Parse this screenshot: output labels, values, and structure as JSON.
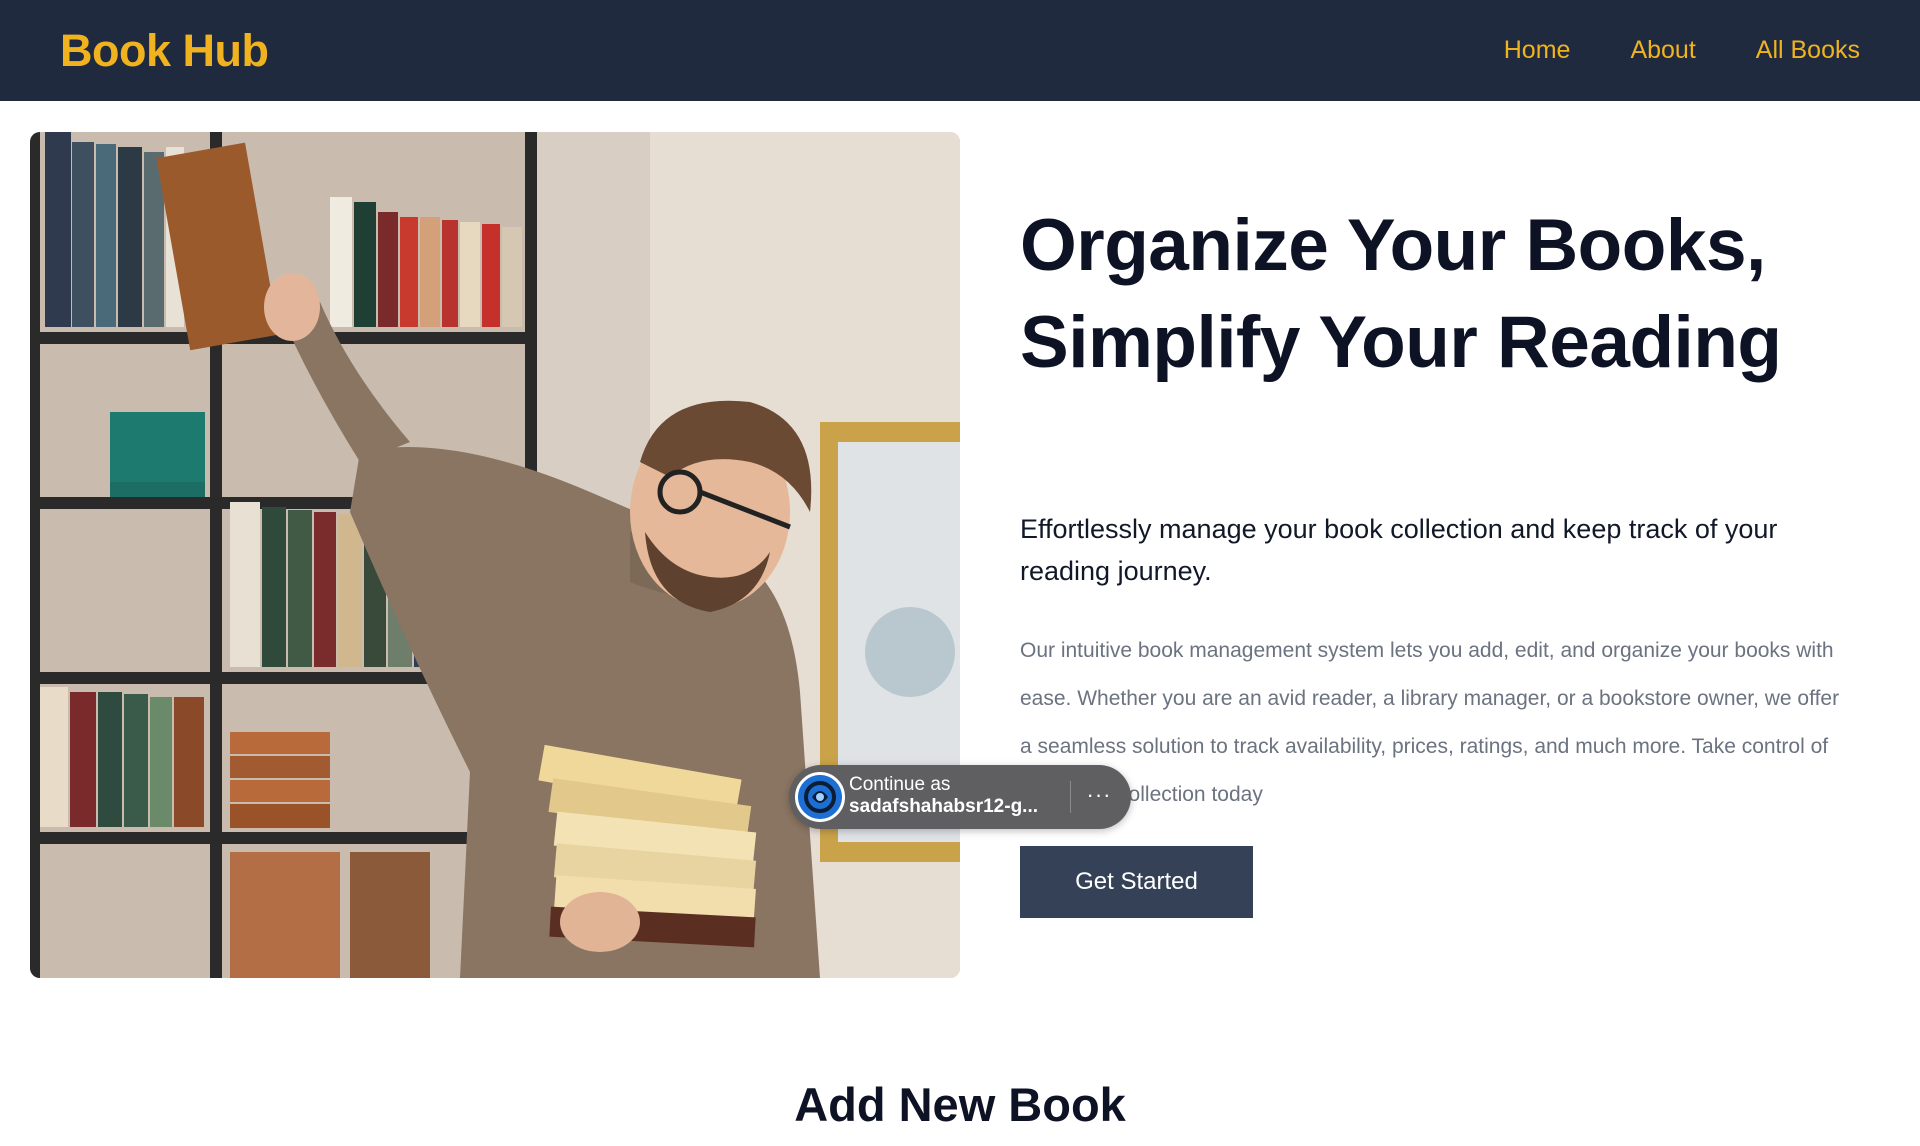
{
  "navbar": {
    "brand": "Book Hub",
    "links": [
      {
        "label": "Home"
      },
      {
        "label": "About"
      },
      {
        "label": "All Books"
      }
    ],
    "colors": {
      "background": "#1f2a3e",
      "accent": "#f0b31f"
    }
  },
  "hero": {
    "image_alt": "Man in glasses placing books on a bookshelf while holding a stack of books",
    "title": "Organize Your Books, Simplify Your Reading",
    "subtitle": "Effortlessly manage your book collection and keep track of your reading journey.",
    "description": "Our intuitive book management system lets you add, edit, and organize your books with ease. Whether you are an avid reader, a library manager, or a bookstore owner, we offer a seamless solution to track availability, prices, ratings, and much more. Take control of your book collection today",
    "cta_label": "Get Started",
    "cta_color": "#344157"
  },
  "signin_prompt": {
    "label": "Continue as",
    "account": "sadafshahabsr12-g...",
    "more_icon": "more-horizontal-icon",
    "more_label": "···"
  },
  "section": {
    "heading": "Add New Book"
  }
}
